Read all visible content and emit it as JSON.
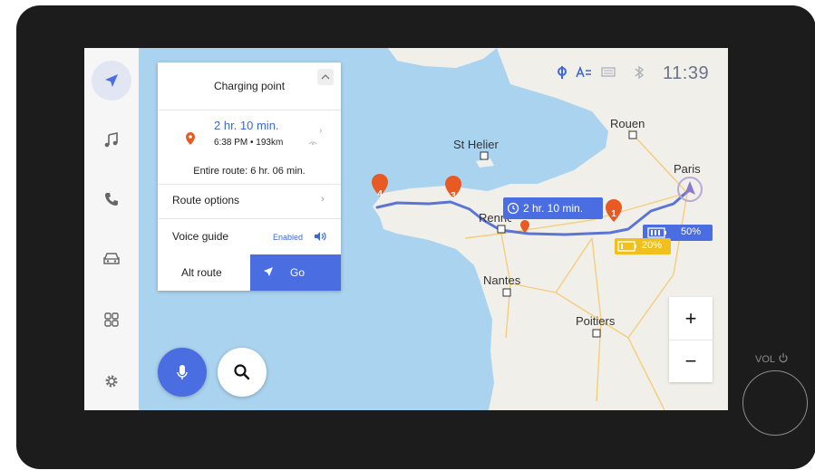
{
  "status_bar": {
    "time": "11:39",
    "icons": [
      "phone-signal-icon",
      "text-size-icon",
      "screen-icon",
      "bluetooth-icon"
    ]
  },
  "sidebar": {
    "items": [
      {
        "name": "navigation",
        "icon": "navigation-arrow-icon",
        "active": true
      },
      {
        "name": "music",
        "icon": "music-note-icon",
        "active": false
      },
      {
        "name": "phone",
        "icon": "phone-icon",
        "active": false
      },
      {
        "name": "car",
        "icon": "car-icon",
        "active": false
      },
      {
        "name": "apps",
        "icon": "apps-grid-icon",
        "active": false
      },
      {
        "name": "settings",
        "icon": "gear-icon",
        "active": false
      }
    ]
  },
  "route_panel": {
    "title": "Charging point",
    "eta_time": "2 hr. 10 min.",
    "eta_detail": "6:38 PM • 193km",
    "entire_route": "Entire route: 6 hr. 06 min.",
    "route_options_label": "Route options",
    "voice_guide_label": "Voice guide",
    "voice_guide_status": "Enabled",
    "alt_route_label": "Alt route",
    "go_label": "Go"
  },
  "map": {
    "cities": [
      "Rouen",
      "St Helier",
      "Paris",
      "Rennes",
      "Nantes",
      "Poitiers"
    ],
    "eta_bubble": "2 hr. 10 min.",
    "stops": [
      "1",
      "3",
      "4"
    ],
    "battery_start": "50%",
    "battery_arrival": "20%",
    "colors": {
      "accent": "#4a6ee2",
      "route": "#5b74d6",
      "water": "#aad3ef",
      "land": "#f1efe9",
      "pin": "#e85a24",
      "battery_low": "#f2c01e"
    }
  },
  "zoom": {
    "in_label": "+",
    "out_label": "−"
  },
  "hardware": {
    "volume_label": "VOL"
  }
}
